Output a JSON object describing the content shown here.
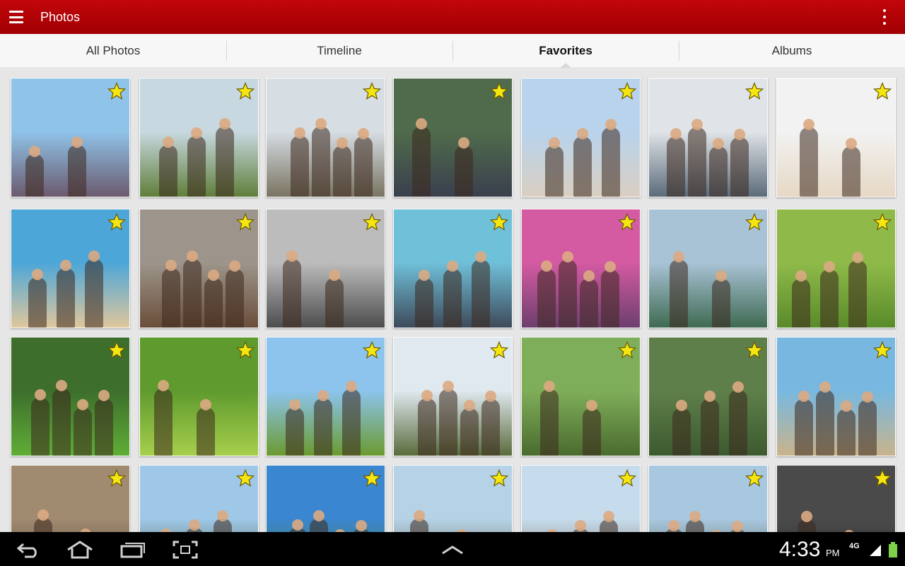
{
  "app": {
    "title": "Photos"
  },
  "tabs": [
    {
      "label": "All Photos",
      "active": false
    },
    {
      "label": "Timeline",
      "active": false
    },
    {
      "label": "Favorites",
      "active": true
    },
    {
      "label": "Albums",
      "active": false
    }
  ],
  "colors": {
    "accent": "#b30206",
    "star": "#f5e611",
    "gallery_bg": "#e6e6e6"
  },
  "icons": {
    "menu": "hamburger-menu-icon",
    "overflow": "overflow-menu-icon",
    "favorite": "star-icon",
    "back": "back-icon",
    "home": "home-icon",
    "recents": "recent-apps-icon",
    "screenshot": "screenshot-icon",
    "up": "chevron-up-icon",
    "signal": "signal-icon",
    "battery": "battery-icon"
  },
  "photos": [
    {
      "scene": "family hiking on rocky hill with heather",
      "sky": "#8fc3e8",
      "ground": "#6b5a6e",
      "favorite": true
    },
    {
      "scene": "friends hiking with backpacks and map",
      "sky": "#c8d8e0",
      "ground": "#5f7f3a",
      "favorite": true
    },
    {
      "scene": "group of friends sitting on rocks",
      "sky": "#d6dde3",
      "ground": "#7a7462",
      "favorite": true
    },
    {
      "scene": "friends looking at phones in a tent",
      "sky": "#4f6b4c",
      "ground": "#3a3f4d",
      "favorite": true
    },
    {
      "scene": "friends in sunglasses at beach",
      "sky": "#b9d3ec",
      "ground": "#d9cfc2",
      "favorite": true
    },
    {
      "scene": "friends selfie in sunglasses",
      "sky": "#e0e4e8",
      "ground": "#5b6b7a",
      "favorite": true
    },
    {
      "scene": "piggyback race on sandy beach",
      "sky": "#f2f2f2",
      "ground": "#e6d8c4",
      "favorite": true
    },
    {
      "scene": "girls running on beach waves",
      "sky": "#4da6d8",
      "ground": "#e0c79c",
      "favorite": true
    },
    {
      "scene": "woman in sunglasses at Colosseum",
      "sky": "#9d958b",
      "ground": "#6a4e3a",
      "favorite": true
    },
    {
      "scene": "couple with headphones smiling",
      "sky": "#bcbcbc",
      "ground": "#4d4d4d",
      "favorite": true
    },
    {
      "scene": "color run powder cloud crowd",
      "sky": "#6fc0d9",
      "ground": "#3e4a5a",
      "favorite": true
    },
    {
      "scene": "faces covered in color powder",
      "sky": "#d45aa2",
      "ground": "#6d3f6e",
      "favorite": true
    },
    {
      "scene": "color run race participants",
      "sky": "#a9c3d6",
      "ground": "#3f6a52",
      "favorite": true
    },
    {
      "scene": "girl hugging friend in grass",
      "sky": "#8fba4a",
      "ground": "#5a8b2a",
      "favorite": true
    },
    {
      "scene": "kids playing soccer on lawn",
      "sky": "#3d6e2c",
      "ground": "#5fae36",
      "favorite": true
    },
    {
      "scene": "child blowing bubbles",
      "sky": "#5e9a2e",
      "ground": "#a7cf4c",
      "favorite": true
    },
    {
      "scene": "man throwing frisbee in field",
      "sky": "#8cc4ee",
      "ground": "#6b9a2f",
      "favorite": true
    },
    {
      "scene": "hikers celebrating on hilltop",
      "sky": "#dfe9ef",
      "ground": "#5a6b3c",
      "favorite": true
    },
    {
      "scene": "hikers smiling with backpacks",
      "sky": "#7fae5a",
      "ground": "#4a6b2e",
      "favorite": true
    },
    {
      "scene": "couple hiking in forest trail",
      "sky": "#5f7f4a",
      "ground": "#3c5a2f",
      "favorite": true
    },
    {
      "scene": "beach volleyball players",
      "sky": "#78b8e0",
      "ground": "#c8b48c",
      "favorite": true
    },
    {
      "scene": "father and child by tent",
      "sky": "#a08a70",
      "ground": "#5a4a3a",
      "favorite": true
    },
    {
      "scene": "hikers pointing at mountains",
      "sky": "#9fc8e8",
      "ground": "#4a5a3a",
      "favorite": true
    },
    {
      "scene": "tree and clouds",
      "sky": "#3a86d0",
      "ground": "#4e7a3a",
      "favorite": true
    },
    {
      "scene": "hiker pointing at horizon",
      "sky": "#b5d2e6",
      "ground": "#6a6a5a",
      "favorite": true
    },
    {
      "scene": "hikers on mountain ridge",
      "sky": "#c6dcec",
      "ground": "#7a6a5a",
      "favorite": true
    },
    {
      "scene": "hikers with backpacks at summit",
      "sky": "#a8c8e0",
      "ground": "#5a5a4a",
      "favorite": true
    },
    {
      "scene": "couple in dark setting",
      "sky": "#4a4a4a",
      "ground": "#2a2a2a",
      "favorite": true
    }
  ],
  "status": {
    "time": "4:33",
    "ampm": "PM",
    "network": "4G"
  }
}
